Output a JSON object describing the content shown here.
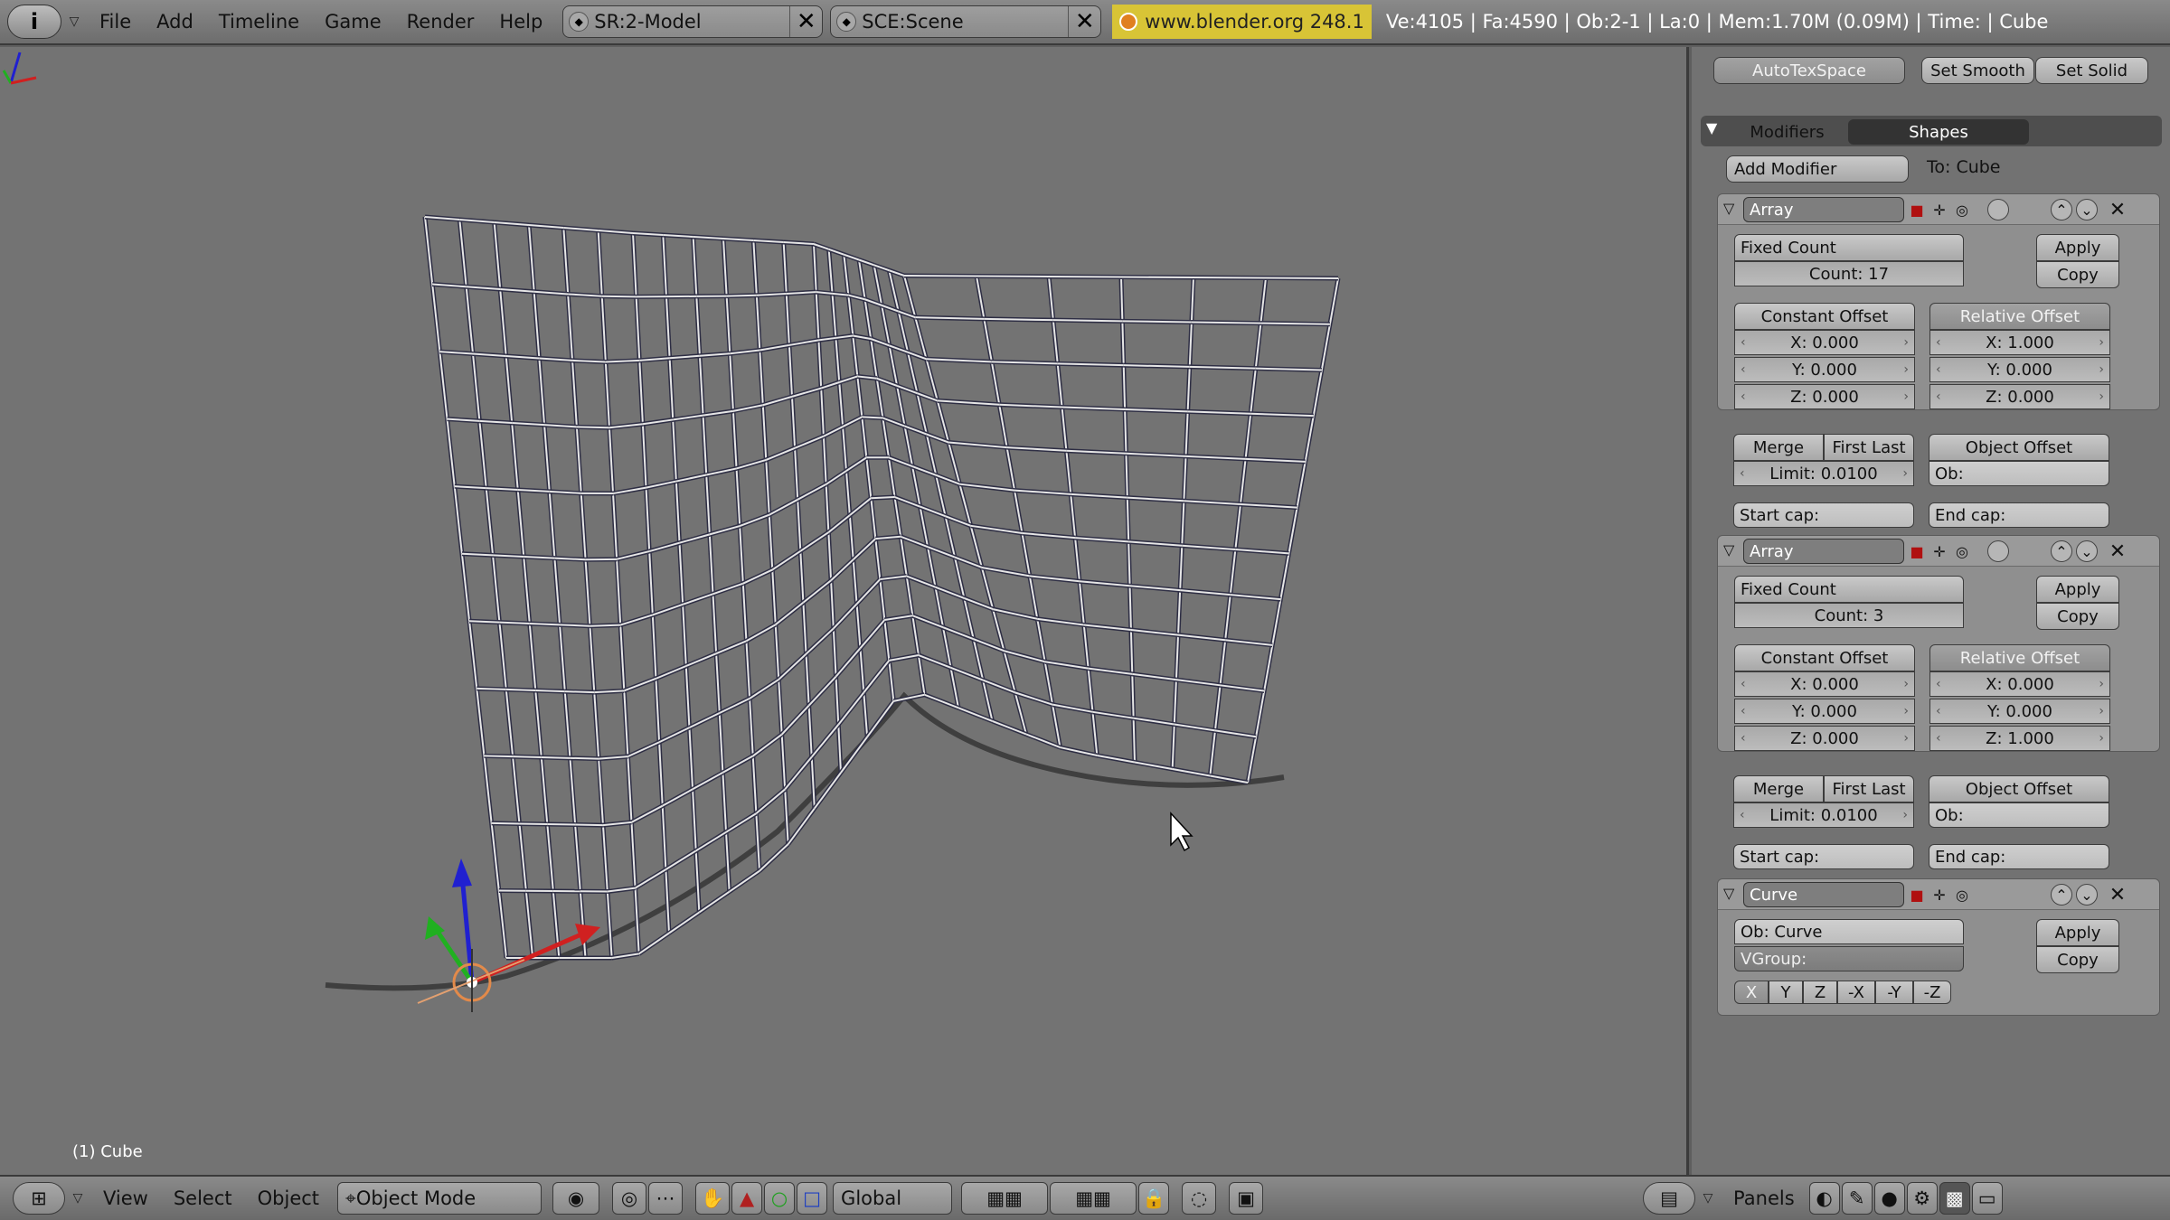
{
  "topbar": {
    "menus": [
      "File",
      "Add",
      "Timeline",
      "Game",
      "Render",
      "Help"
    ],
    "screen": "SR:2-Model",
    "scene": "SCE:Scene",
    "url": "www.blender.org 248.1",
    "stats": "Ve:4105 | Fa:4590 | Ob:2-1 | La:0 | Mem:1.70M (0.09M) | Time: | Cube"
  },
  "viewport": {
    "object_label": "(1) Cube"
  },
  "bottombar": {
    "menus": [
      "View",
      "Select",
      "Object"
    ],
    "mode": "Object Mode",
    "orientation": "Global",
    "panels_label": "Panels"
  },
  "props": {
    "autotexspace": "AutoTexSpace",
    "set_smooth": "Set Smooth",
    "set_solid": "Set Solid",
    "tab_modifiers": "Modifiers",
    "tab_shapes": "Shapes",
    "add_modifier": "Add Modifier",
    "to_label": "To: Cube",
    "modifiers": [
      {
        "name": "Array",
        "fit_type": "Fixed Count",
        "count": "Count: 17",
        "apply": "Apply",
        "copy": "Copy",
        "constant_offset": "Constant Offset",
        "relative_offset": "Relative Offset",
        "const": [
          "X: 0.000",
          "Y: 0.000",
          "Z: 0.000"
        ],
        "rel": [
          "X: 1.000",
          "Y: 0.000",
          "Z: 0.000"
        ],
        "merge": "Merge",
        "first_last": "First Last",
        "object_offset": "Object Offset",
        "limit": "Limit: 0.0100",
        "ob": "Ob:",
        "start_cap": "Start cap:",
        "end_cap": "End cap:"
      },
      {
        "name": "Array",
        "fit_type": "Fixed Count",
        "count": "Count: 3",
        "apply": "Apply",
        "copy": "Copy",
        "constant_offset": "Constant Offset",
        "relative_offset": "Relative Offset",
        "const": [
          "X: 0.000",
          "Y: 0.000",
          "Z: 0.000"
        ],
        "rel": [
          "X: 0.000",
          "Y: 0.000",
          "Z: 1.000"
        ],
        "merge": "Merge",
        "first_last": "First Last",
        "object_offset": "Object Offset",
        "limit": "Limit: 0.0100",
        "ob": "Ob:",
        "start_cap": "Start cap:",
        "end_cap": "End cap:"
      }
    ],
    "curve": {
      "name": "Curve",
      "ob": "Ob: Curve",
      "vgroup": "VGroup:",
      "apply": "Apply",
      "copy": "Copy",
      "axes": [
        "X",
        "Y",
        "Z",
        "-X",
        "-Y",
        "-Z"
      ]
    }
  },
  "colors": {
    "viewport_bg": "#737373",
    "wire": "#e6e6e6",
    "url_bg": "#d8c436"
  }
}
